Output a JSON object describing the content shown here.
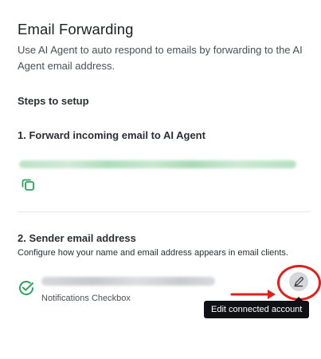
{
  "section": {
    "title": "Email Forwarding",
    "description": "Use AI Agent to auto respond to emails by forwarding to the AI Agent email address.",
    "steps_heading": "Steps to setup"
  },
  "step1": {
    "heading": "1. Forward incoming email to AI Agent",
    "copy_icon": "copy-icon"
  },
  "step2": {
    "heading": "2. Sender email address",
    "description": "Configure how your name and email address appears in email clients.",
    "sender_subtitle": "Notifications Checkbox",
    "status_icon": "check-circle-icon",
    "edit_icon": "pencil-icon",
    "edit_tooltip": "Edit connected account"
  },
  "colors": {
    "accent_green": "#2fa25b",
    "annotation_red": "#e0201c",
    "tooltip_bg": "#0f1115"
  }
}
